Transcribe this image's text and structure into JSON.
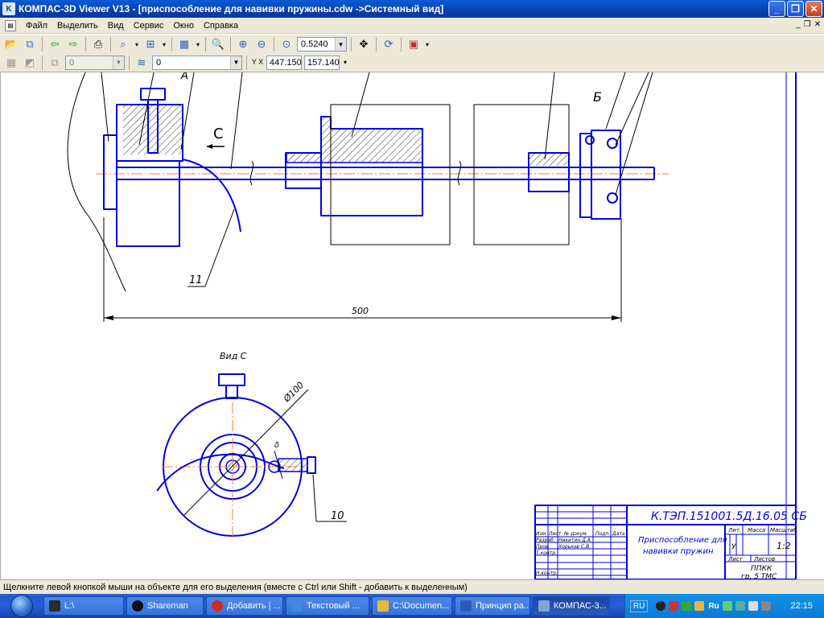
{
  "window": {
    "title": "КОМПАС-3D Viewer V13 - [приспособление для навивки пружины.cdw ->Системный вид]",
    "app_icon": "kompas-icon"
  },
  "menu": {
    "items": [
      "Файл",
      "Выделить",
      "Вид",
      "Сервис",
      "Окно",
      "Справка"
    ]
  },
  "toolbar": {
    "zoom_value": "0.5240"
  },
  "toolbar2": {
    "layer_value": "0",
    "style_value": "0",
    "coord_label": "Y X",
    "coord_x": "447.150",
    "coord_y": "157.140"
  },
  "drawing": {
    "label_a": "A",
    "label_b": "Б",
    "label_c": "C",
    "callout_11": "11",
    "callout_10": "10",
    "dimension_500": "500",
    "view_c_title": "Вид С",
    "diameter": "Ø100",
    "angle": "δ",
    "title_block": {
      "code": "К.ТЭП.151001.5Д.16.05 СБ",
      "name_line1": "Приспособление для",
      "name_line2": "навивки пружин",
      "col_izm": "Изм",
      "col_list": "Лист",
      "col_doc": "№ докум.",
      "col_sign": "Подп.",
      "col_date": "Дата",
      "razrab": "Разраб.",
      "razrab_name": "Никитин Д.А.",
      "prov": "Пров.",
      "prov_name": "Хорьков С.В.",
      "tkontr": "Т.контр.",
      "nkontr": "Н.контр.",
      "lit": "Лит.",
      "massa": "Масса",
      "masshtab": "Масштаб",
      "lit_val": "У",
      "masshtab_val": "1:2",
      "list": "Лист",
      "listov": "Листов",
      "org1": "ППКК",
      "org2": "гр. 5 ТМС"
    }
  },
  "status": {
    "text": "Щелкните левой кнопкой мыши на объекте для его выделения (вместе с Ctrl или Shift - добавить к выделенным)"
  },
  "taskbar": {
    "items": [
      {
        "label": "L:\\",
        "color": "#2c2c2c"
      },
      {
        "label": "Shareman",
        "color": "#111111"
      },
      {
        "label": "Добавить | ...",
        "color": "#d22b1f"
      },
      {
        "label": "Текстовый ...",
        "color": "#3b8be0"
      },
      {
        "label": "C:\\Documen...",
        "color": "#e8b83a"
      },
      {
        "label": "Принцип ра...",
        "color": "#2b5bb5"
      },
      {
        "label": "КОМПАС-3...",
        "color": "#7aa6d8"
      }
    ],
    "lang": "RU",
    "lang2": "Ru",
    "clock": "22:15"
  },
  "colors": {
    "drawing_blue": "#0000e0",
    "axis_orange": "#ff7f27",
    "title_bar": "#0a5bd8"
  }
}
